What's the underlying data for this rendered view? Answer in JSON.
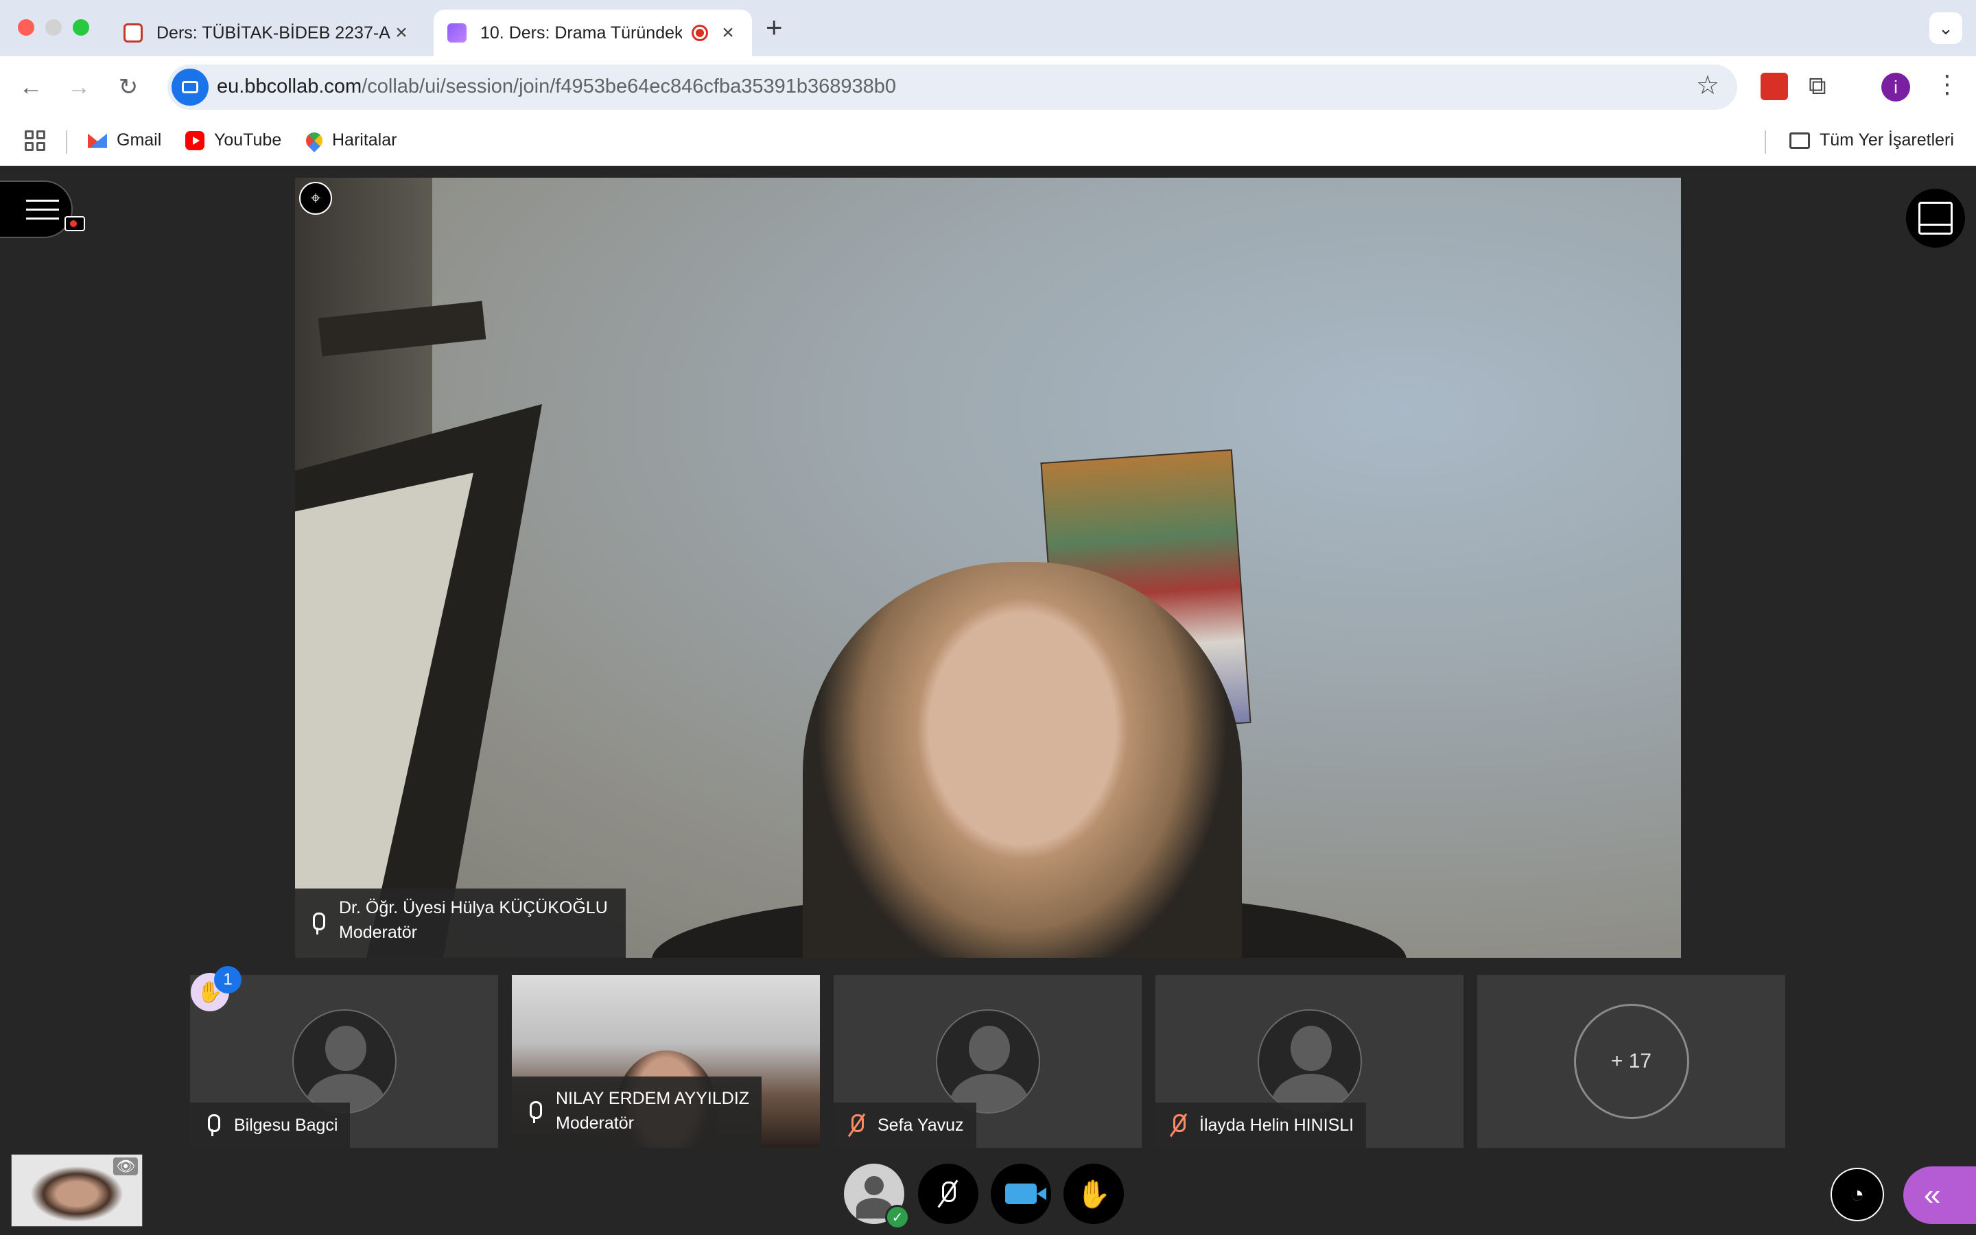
{
  "browser": {
    "tabs": [
      {
        "title": "Ders: TÜBİTAK-BİDEB 2237-A",
        "active": false
      },
      {
        "title": "10. Ders: Drama Türündek",
        "active": true,
        "recording": true
      }
    ],
    "new_tab_symbol": "+",
    "url_host": "eu.bbcollab.com",
    "url_path": "/collab/ui/session/join/f4953be64ec846cfba35391b368938b0",
    "profile_initial": "i",
    "bookmarks": [
      {
        "label": "Gmail",
        "icon": "gmail-icon"
      },
      {
        "label": "YouTube",
        "icon": "youtube-icon"
      },
      {
        "label": "Haritalar",
        "icon": "maps-icon"
      }
    ],
    "all_bookmarks_label": "Tüm Yer İşaretleri"
  },
  "session": {
    "main_speaker": {
      "name": "Dr. Öğr. Üyesi Hülya KÜÇÜKOĞLU",
      "role": "Moderatör",
      "mic": "on"
    },
    "participants": [
      {
        "name": "Bilgesu Bagci",
        "role": "",
        "mic": "on",
        "video": false
      },
      {
        "name": "NILAY ERDEM AYYILDIZ",
        "role": "Moderatör",
        "mic": "on",
        "video": true
      },
      {
        "name": "Sefa Yavuz",
        "role": "",
        "mic": "off",
        "video": false
      },
      {
        "name": "İlayda Helin HINISLI",
        "role": "",
        "mic": "off",
        "video": false
      }
    ],
    "more_participants": "+ 17",
    "raised_hands_count": "1"
  },
  "colors": {
    "app_background": "#262626",
    "panel_accent": "#b55bd3",
    "camera_active": "#3fa7e8",
    "mic_muted": "#ff8a65",
    "browser_accent": "#1a73e8"
  }
}
